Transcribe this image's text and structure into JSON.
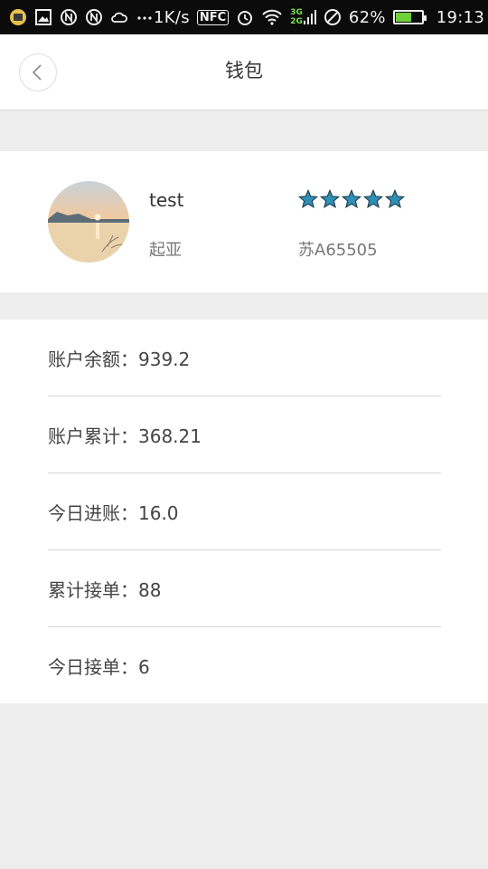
{
  "status_bar": {
    "net_speed": "1K/s",
    "network_3g": "3G",
    "network_2g": "2G",
    "battery_percent": "62%",
    "battery_level": 0.62,
    "time": "19:13",
    "icons": [
      "app-icon",
      "image-icon",
      "n-icon",
      "n-icon",
      "cloud-icon",
      "more-icon",
      "nfc-icon",
      "alarm-icon",
      "wifi-icon",
      "signal-icon",
      "blocked-icon",
      "battery-icon"
    ]
  },
  "navbar": {
    "title": "钱包",
    "back_icon": "chevron-left-icon"
  },
  "profile": {
    "name": "test",
    "car_brand": "起亚",
    "plate": "苏A65505",
    "rating": 5,
    "star_color": "#2f8fb5"
  },
  "stats": [
    {
      "label": "账户余额：939.2"
    },
    {
      "label": "账户累计：368.21"
    },
    {
      "label": "今日进账：16.0"
    },
    {
      "label": "累计接单：88"
    },
    {
      "label": "今日接单：6"
    }
  ]
}
